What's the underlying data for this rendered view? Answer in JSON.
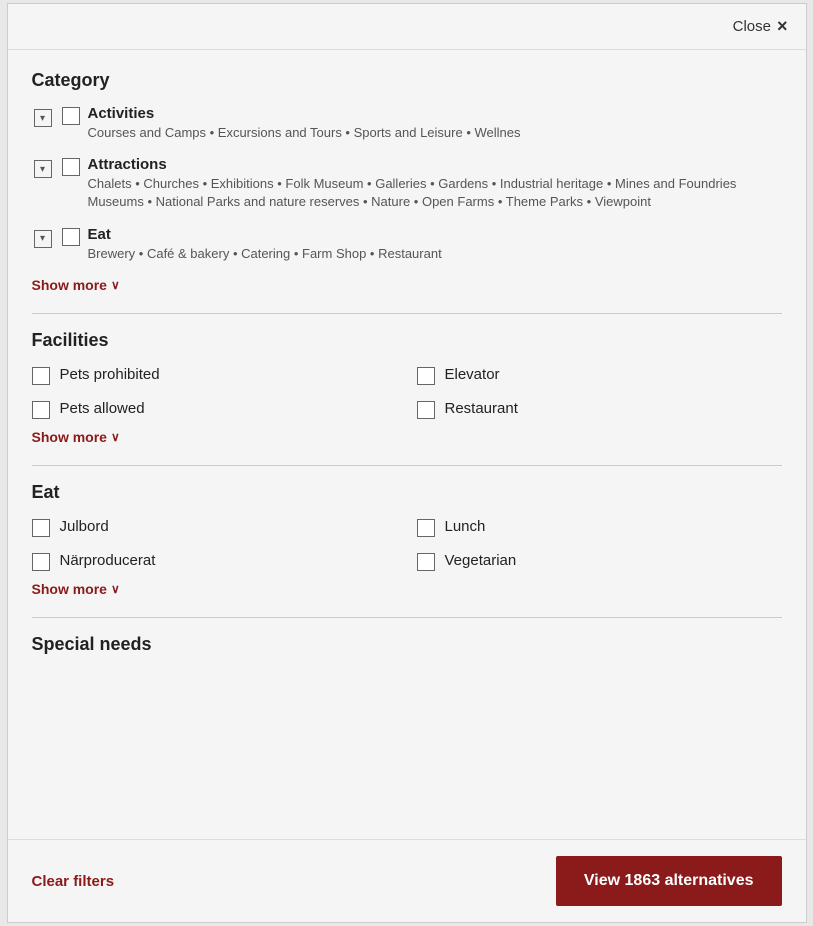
{
  "header": {
    "close_label": "Close",
    "close_icon": "×"
  },
  "category_section": {
    "title": "Category",
    "items": [
      {
        "name": "Activities",
        "subcategories": "Courses and Camps • Excursions and Tours • Sports and Leisure • Wellnes"
      },
      {
        "name": "Attractions",
        "subcategories": "Chalets • Churches • Exhibitions • Folk Museum • Galleries • Gardens • Industrial heritage • Mines and Foundries Museums • National Parks and nature reserves • Nature • Open Farms • Theme Parks • Viewpoint"
      },
      {
        "name": "Eat",
        "subcategories": "Brewery • Café & bakery • Catering • Farm Shop • Restaurant"
      }
    ],
    "show_more": "Show more",
    "show_more_arrow": "∨"
  },
  "facilities_section": {
    "title": "Facilities",
    "items_left": [
      {
        "label": "Pets prohibited"
      },
      {
        "label": "Pets allowed"
      }
    ],
    "items_right": [
      {
        "label": "Elevator"
      },
      {
        "label": "Restaurant"
      }
    ],
    "show_more": "Show more",
    "show_more_arrow": "∨"
  },
  "eat_section": {
    "title": "Eat",
    "items_left": [
      {
        "label": "Julbord"
      },
      {
        "label": "Närproducerat"
      }
    ],
    "items_right": [
      {
        "label": "Lunch"
      },
      {
        "label": "Vegetarian"
      }
    ],
    "show_more": "Show more",
    "show_more_arrow": "∨"
  },
  "special_needs_section": {
    "title": "Special needs"
  },
  "footer": {
    "clear_label": "Clear filters",
    "view_label": "View 1863 alternatives"
  }
}
